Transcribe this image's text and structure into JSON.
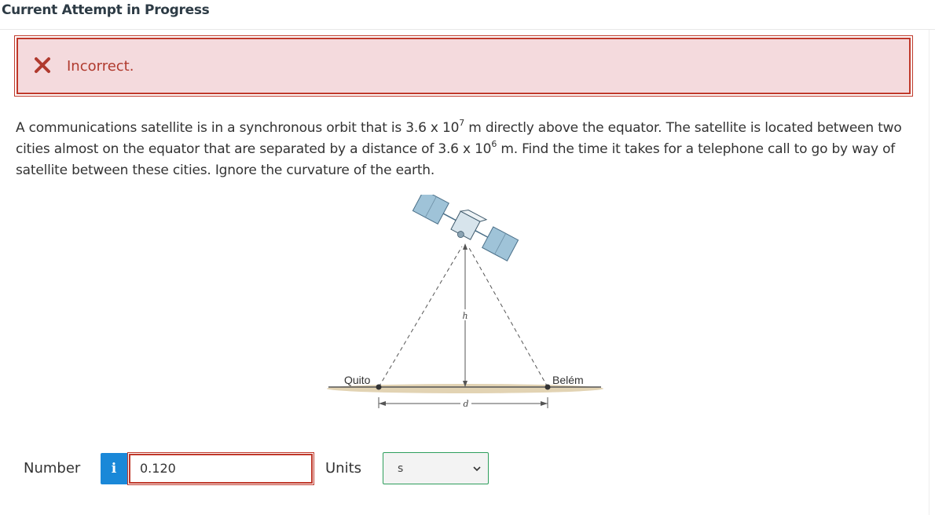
{
  "header": {
    "title": "Current Attempt in Progress"
  },
  "feedback": {
    "status": "Incorrect.",
    "icon": "x-mark-icon",
    "color": "#c0392b"
  },
  "question": {
    "text_a": "A communications satellite is in a synchronous orbit that is 3.6 x 10",
    "exp_a": "7",
    "text_b": " m directly above the equator. The satellite is located between two cities almost on the equator that are separated by a distance of 3.6 x 10",
    "exp_b": "6",
    "text_c": " m. Find the time it takes for a telephone call to go by way of satellite between these cities. Ignore the curvature of the earth."
  },
  "figure": {
    "city_left": "Quito",
    "city_right": "Belém",
    "height_label": "h",
    "distance_label": "d"
  },
  "answer": {
    "number_label": "Number",
    "info_icon": "info-icon",
    "info_glyph": "i",
    "value": "0.120",
    "units_label": "Units",
    "units_value": "s"
  }
}
